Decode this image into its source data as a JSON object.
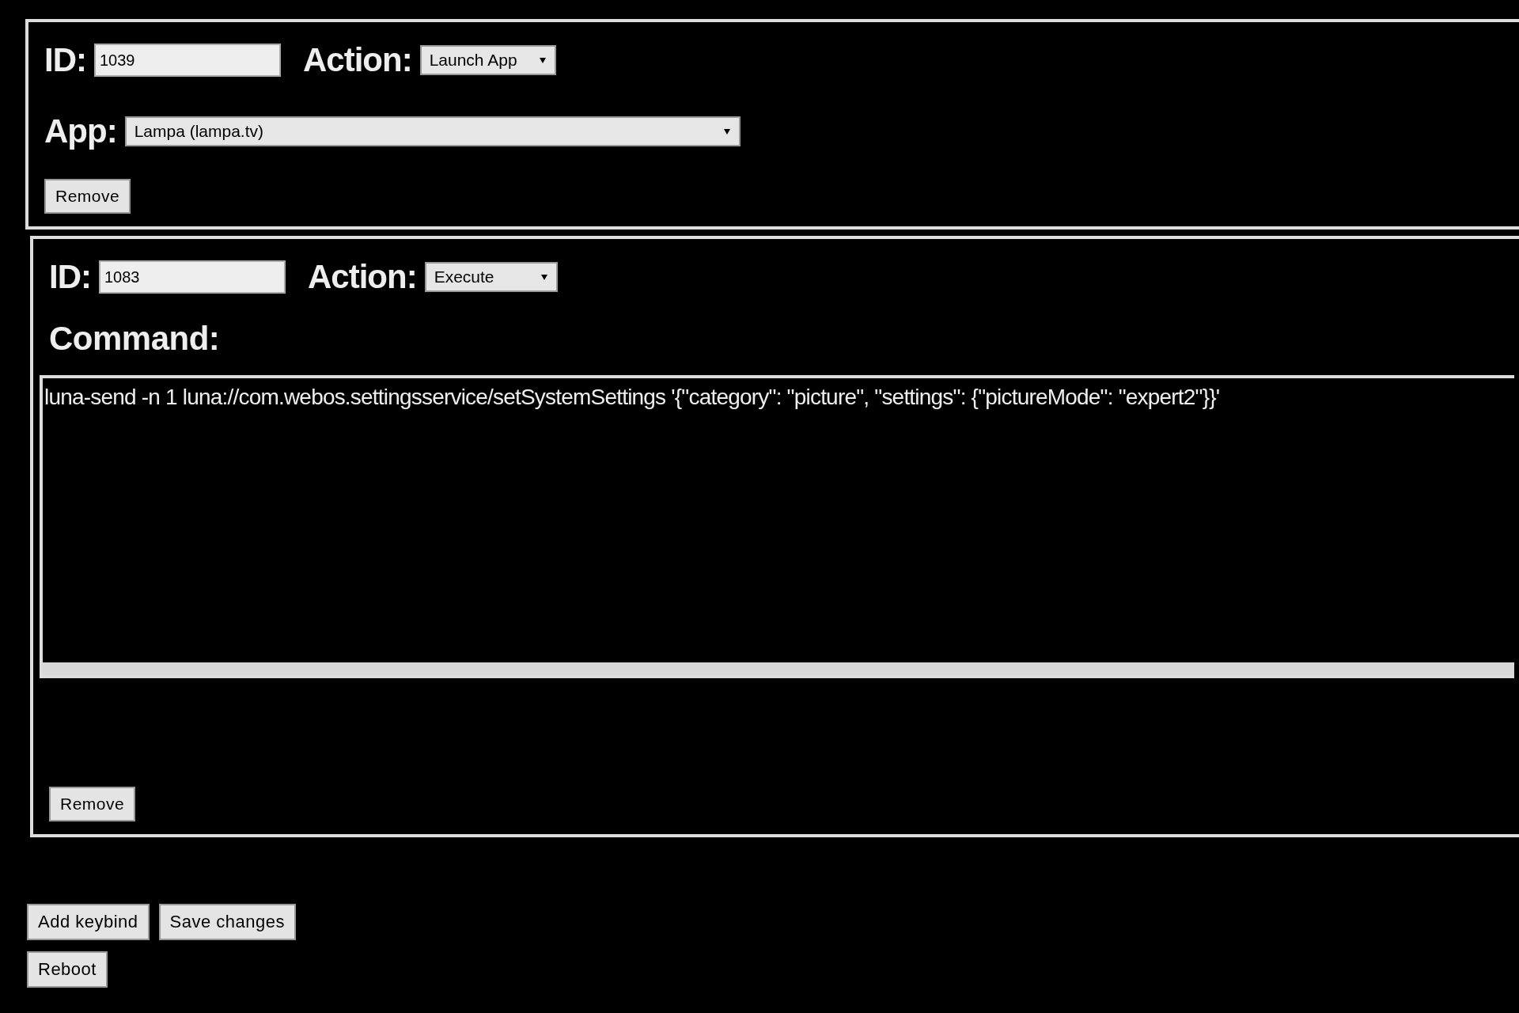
{
  "keybinds": [
    {
      "kind": "launch_app",
      "id_label": "ID:",
      "id": "1039",
      "action_label": "Action:",
      "action": "Launch App",
      "app_label": "App:",
      "app": "Lampa (lampa.tv)",
      "remove": "Remove"
    },
    {
      "kind": "execute",
      "id_label": "ID:",
      "id": "1083",
      "action_label": "Action:",
      "action": "Execute",
      "command_label": "Command:",
      "command": "luna-send -n 1 luna://com.webos.settingsservice/setSystemSettings '{\"category\": \"picture\", \"settings\": {\"pictureMode\": \"expert2\"}}'",
      "remove": "Remove"
    }
  ],
  "button_rows": [
    [
      "Add keybind",
      "Save changes"
    ],
    [
      "Reboot"
    ]
  ]
}
